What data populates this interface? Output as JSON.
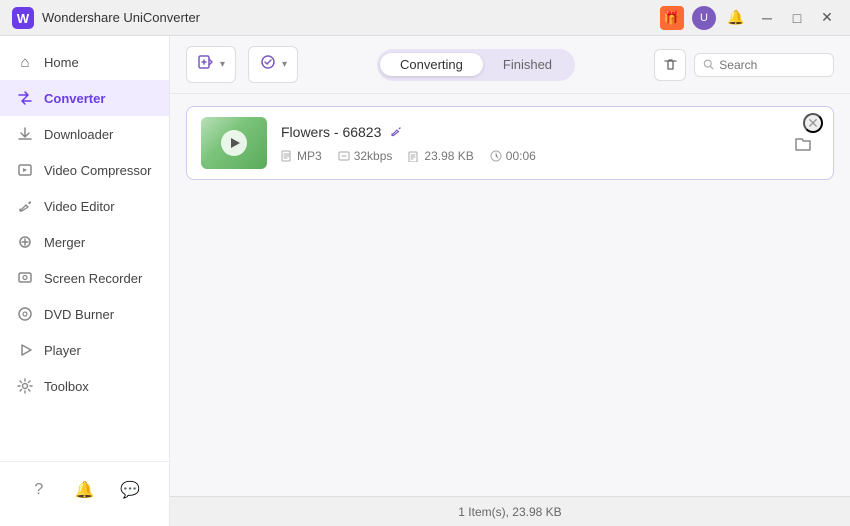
{
  "app": {
    "title": "Wondershare UniConverter",
    "logo_text": "W"
  },
  "titlebar": {
    "gift_icon": "🎁",
    "avatar_letter": "U",
    "bell_icon": "🔔",
    "minimize_icon": "─",
    "maximize_icon": "□",
    "close_icon": "✕"
  },
  "sidebar": {
    "items": [
      {
        "id": "home",
        "label": "Home",
        "icon": "⌂"
      },
      {
        "id": "converter",
        "label": "Converter",
        "icon": "⇄",
        "active": true
      },
      {
        "id": "downloader",
        "label": "Downloader",
        "icon": "↓"
      },
      {
        "id": "video-compressor",
        "label": "Video Compressor",
        "icon": "⊡"
      },
      {
        "id": "video-editor",
        "label": "Video Editor",
        "icon": "✂"
      },
      {
        "id": "merger",
        "label": "Merger",
        "icon": "⊕"
      },
      {
        "id": "screen-recorder",
        "label": "Screen Recorder",
        "icon": "⬜"
      },
      {
        "id": "dvd-burner",
        "label": "DVD Burner",
        "icon": "⊙"
      },
      {
        "id": "player",
        "label": "Player",
        "icon": "▶"
      },
      {
        "id": "toolbox",
        "label": "Toolbox",
        "icon": "⚙"
      }
    ],
    "bottom_icons": [
      {
        "id": "help",
        "icon": "?"
      },
      {
        "id": "notifications",
        "icon": "🔔"
      },
      {
        "id": "messages",
        "icon": "💬"
      }
    ]
  },
  "toolbar": {
    "add_btn_label": "",
    "add_dropdown_icon": "▾",
    "optimize_btn_label": "",
    "optimize_dropdown_icon": "▾"
  },
  "tabs": [
    {
      "id": "converting",
      "label": "Converting",
      "active": true
    },
    {
      "id": "finished",
      "label": "Finished",
      "active": false
    }
  ],
  "search": {
    "placeholder": "Search"
  },
  "file_list": {
    "items": [
      {
        "id": "flowers-66823",
        "name": "Flowers - 66823",
        "format": "MP3",
        "bitrate": "32kbps",
        "size": "23.98 KB",
        "duration": "00:06"
      }
    ]
  },
  "status_bar": {
    "text": "1 Item(s), 23.98 KB"
  }
}
